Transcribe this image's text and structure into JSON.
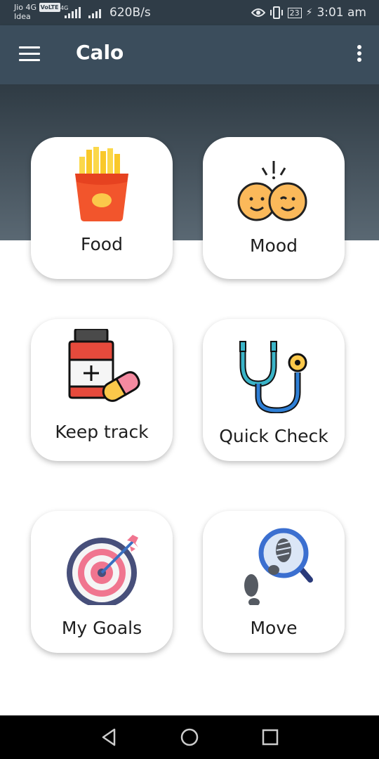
{
  "status_bar": {
    "carrier1": "Jio 4G",
    "volte": "VoLTE",
    "carrier2": "Idea",
    "lte": "4G",
    "speed": "620B/s",
    "battery": "23",
    "time": "3:01 am"
  },
  "app_bar": {
    "title": "Calo"
  },
  "tiles": [
    {
      "label": "Food",
      "icon": "french-fries-icon"
    },
    {
      "label": "Mood",
      "icon": "mood-faces-icon"
    },
    {
      "label": "Keep track",
      "icon": "medicine-icon"
    },
    {
      "label": "Quick Check",
      "icon": "stethoscope-icon"
    },
    {
      "label": "My Goals",
      "icon": "target-icon"
    },
    {
      "label": "Move",
      "icon": "footsteps-search-icon"
    }
  ],
  "nav_bar": {
    "buttons": [
      "back-icon",
      "home-icon",
      "recents-icon"
    ]
  }
}
